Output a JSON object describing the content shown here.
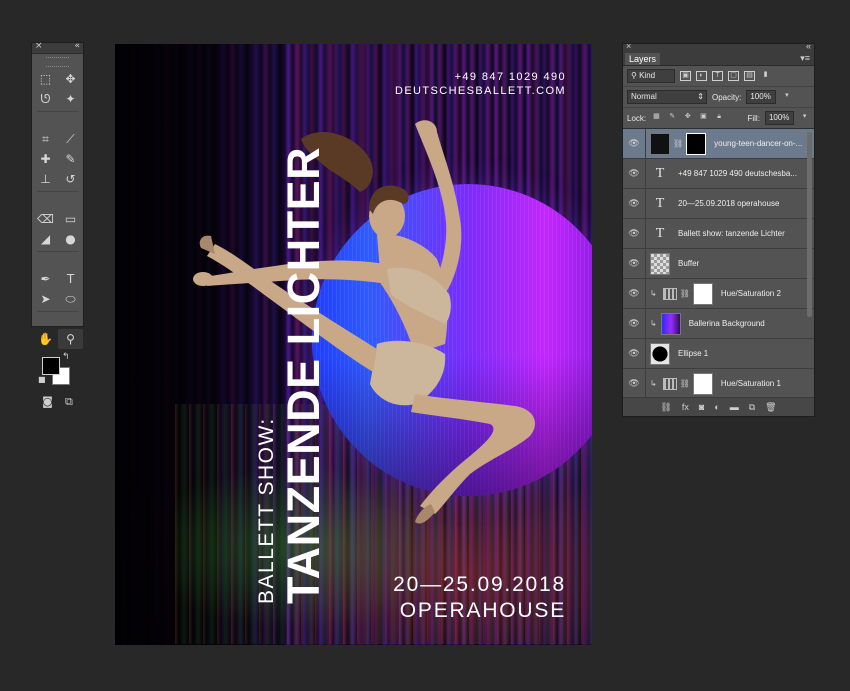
{
  "tools_panel": {
    "close": "×",
    "collapse": "«",
    "items": [
      {
        "name": "marquee-tool",
        "glyph": "⬚"
      },
      {
        "name": "move-tool",
        "glyph": "✥"
      },
      {
        "name": "lasso-tool",
        "glyph": "ᘎ"
      },
      {
        "name": "magic-wand-tool",
        "glyph": "✦"
      },
      {
        "name": "crop-tool",
        "glyph": "⌗"
      },
      {
        "name": "eyedropper-tool",
        "glyph": "⟋"
      },
      {
        "name": "healing-brush-tool",
        "glyph": "✚"
      },
      {
        "name": "brush-tool",
        "glyph": "✎"
      },
      {
        "name": "clone-stamp-tool",
        "glyph": "⊥"
      },
      {
        "name": "history-brush-tool",
        "glyph": "↺"
      },
      {
        "name": "eraser-tool",
        "glyph": "⌫"
      },
      {
        "name": "gradient-tool",
        "glyph": "▭"
      },
      {
        "name": "blur-tool",
        "glyph": "◢"
      },
      {
        "name": "dodge-tool",
        "glyph": "●"
      },
      {
        "name": "pen-tool",
        "glyph": "✒"
      },
      {
        "name": "type-tool",
        "glyph": "T"
      },
      {
        "name": "path-selection-tool",
        "glyph": "➤"
      },
      {
        "name": "ellipse-tool",
        "glyph": "⬭"
      },
      {
        "name": "hand-tool",
        "glyph": "✋"
      },
      {
        "name": "zoom-tool",
        "glyph": "⚲"
      }
    ],
    "swap_glyph": "↰",
    "default_glyph": "■",
    "quick_mask_glyph": "◙",
    "screen_mode_glyph": "⧉"
  },
  "poster": {
    "phone": "+49 847 1029 490",
    "website": "DEUTSCHESBALLETT.COM",
    "subtitle": "BALLETT SHOW:",
    "title": "TANZENDE LICHTER",
    "dates": "20—25.09.2018",
    "venue": "OPERAHOUSE"
  },
  "layers_panel": {
    "close": "×",
    "collapse": "«",
    "tab": "Layers",
    "menu": "▾≡",
    "filter_kind": "Kind",
    "blend_mode": "Normal",
    "opacity_label": "Opacity:",
    "opacity_value": "100%",
    "lock_label": "Lock:",
    "fill_label": "Fill:",
    "fill_value": "100%",
    "layers": [
      {
        "name": "young-teen-dancer-on-...",
        "type": "image-mask",
        "selected": true
      },
      {
        "name": "+49 847 1029 490 deutschesba...",
        "type": "text"
      },
      {
        "name": "20—25.09.2018 operahouse",
        "type": "text"
      },
      {
        "name": "Ballett show: tanzende Lichter",
        "type": "text"
      },
      {
        "name": "Buffer",
        "type": "image"
      },
      {
        "name": "Hue/Saturation 2",
        "type": "adjustment"
      },
      {
        "name": "Ballerina Background",
        "type": "image-clip"
      },
      {
        "name": "Ellipse 1",
        "type": "shape"
      },
      {
        "name": "Hue/Saturation 1",
        "type": "adjustment"
      }
    ],
    "bottom_icons": [
      "link-icon",
      "fx-icon",
      "mask-icon",
      "adjustment-icon",
      "folder-icon",
      "new-layer-icon",
      "trash-icon"
    ]
  },
  "colors": {
    "app_bg": "#282828",
    "panel_bg": "#535353",
    "selected_layer": "#6c7a8d"
  }
}
